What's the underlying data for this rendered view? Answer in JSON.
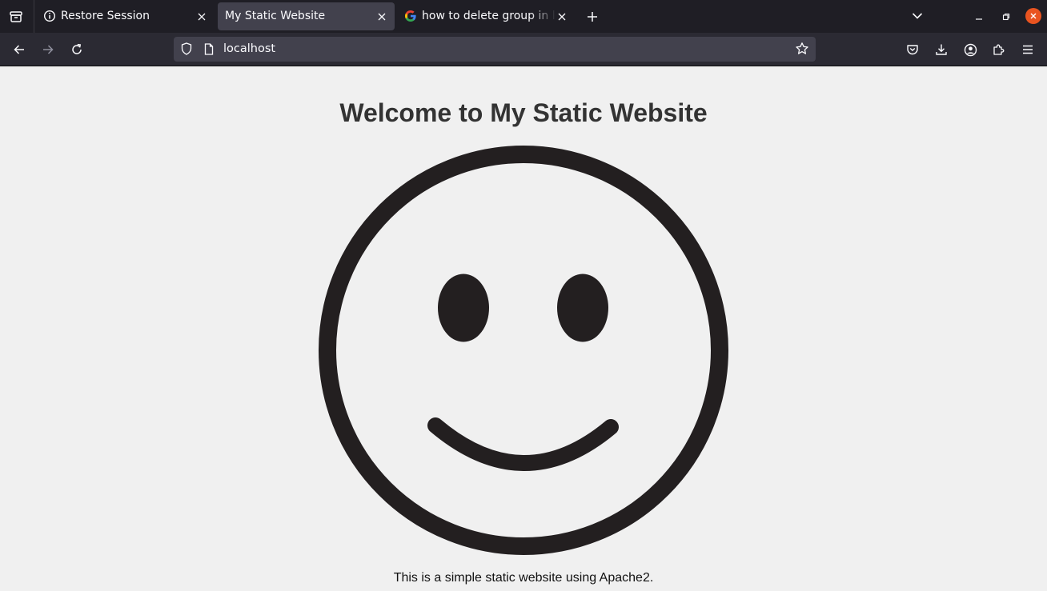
{
  "browser": {
    "tabs": [
      {
        "title": "Restore Session",
        "favicon": "info-icon",
        "active": false
      },
      {
        "title": "My Static Website",
        "favicon": "none",
        "active": true
      },
      {
        "title": "how to delete group in linux",
        "favicon": "google-g-icon",
        "active": false
      }
    ],
    "address": "localhost"
  },
  "page": {
    "heading": "Welcome to My Static Website",
    "image": "smiley-face",
    "caption": "This is a simple static website using Apache2."
  },
  "colors": {
    "tabbar_bg": "#1f1e25",
    "navbar_bg": "#2b2a33",
    "active_tab_bg": "#42414d",
    "page_bg": "#f0f0f0",
    "smiley_stroke": "#231f20",
    "close_button": "#e95420"
  }
}
